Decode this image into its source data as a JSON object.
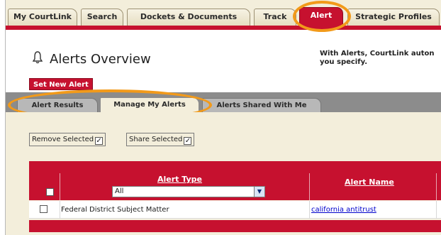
{
  "top_tabs": [
    {
      "label": "My CourtLink"
    },
    {
      "label": "Search"
    },
    {
      "label": "Dockets & Documents"
    },
    {
      "label": "Track"
    },
    {
      "label": "Alert"
    },
    {
      "label": "Strategic Profiles"
    }
  ],
  "header": {
    "title": "Alerts Overview",
    "intro_line1": "With Alerts, CourtLink auton",
    "intro_line2": "you specify."
  },
  "set_new_alert_label": "Set New Alert",
  "sub_tabs": [
    {
      "label": "Alert Results"
    },
    {
      "label": "Manage My Alerts"
    },
    {
      "label": "Alerts Shared With Me"
    }
  ],
  "actions": {
    "remove_label": "Remove Selected",
    "share_label": "Share Selected",
    "check_glyph": "✓"
  },
  "table": {
    "headers": {
      "alert_type": "Alert Type",
      "alert_name": "Alert Name"
    },
    "filter_value": "All",
    "rows": [
      {
        "alert_type": "Federal District Subject Matter",
        "alert_name": "california antitrust"
      }
    ]
  },
  "colors": {
    "brand_red": "#c6112f",
    "highlight": "#f29a1a",
    "tab_bg": "#f3eedb"
  },
  "icons": {
    "alert": "bell-icon",
    "dropdown": "chevron-down-icon"
  }
}
